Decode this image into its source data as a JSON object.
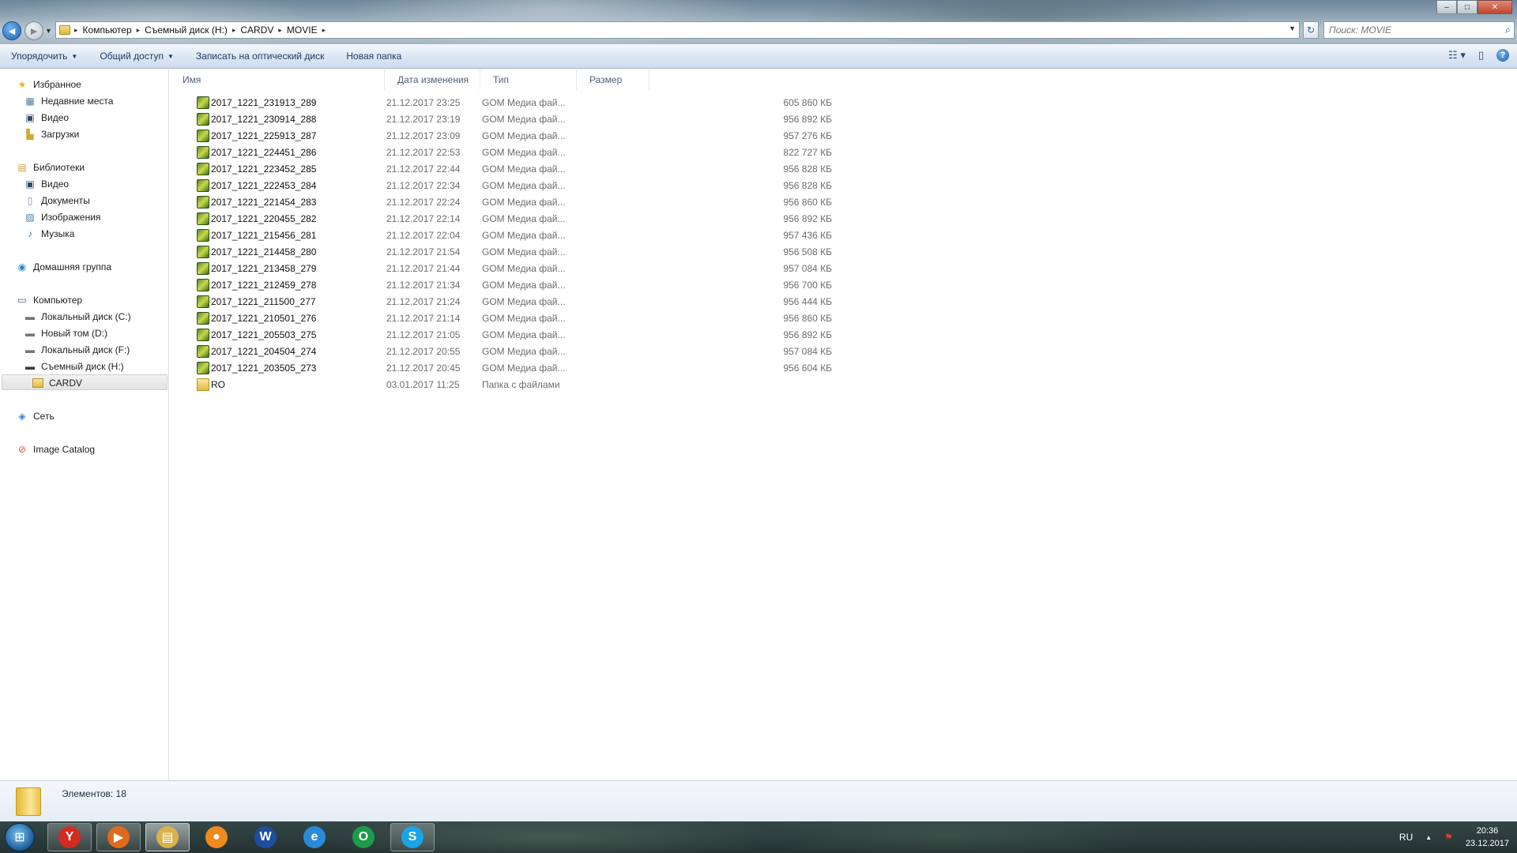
{
  "window": {
    "minimize": "–",
    "maximize": "□",
    "close": "✕"
  },
  "address": {
    "crumbs": [
      "Компьютер",
      "Съемный диск (H:)",
      "CARDV",
      "MOVIE"
    ]
  },
  "search": {
    "placeholder": "Поиск: MOVIE"
  },
  "toolbar": {
    "organize": "Упорядочить",
    "share": "Общий доступ",
    "burn": "Записать на оптический диск",
    "new_folder": "Новая папка"
  },
  "nav": {
    "favorites": "Избранное",
    "recent": "Недавние места",
    "video_fav": "Видео",
    "downloads": "Загрузки",
    "libraries": "Библиотеки",
    "video_lib": "Видео",
    "documents": "Документы",
    "images": "Изображения",
    "music": "Музыка",
    "homegroup": "Домашняя группа",
    "computer": "Компьютер",
    "drive_c": "Локальный диск (C:)",
    "drive_d": "Новый том (D:)",
    "drive_f": "Локальный диск (F:)",
    "drive_h": "Съемный диск (H:)",
    "cardv": "CARDV",
    "network": "Сеть",
    "image_catalog": "Image Catalog"
  },
  "columns": {
    "name": "Имя",
    "date": "Дата изменения",
    "type": "Тип",
    "size": "Размер"
  },
  "files": [
    {
      "name": "2017_1221_231913_289",
      "date": "21.12.2017 23:25",
      "type": "GOM Медиа фай...",
      "size": "605 860 КБ",
      "kind": "video"
    },
    {
      "name": "2017_1221_230914_288",
      "date": "21.12.2017 23:19",
      "type": "GOM Медиа фай...",
      "size": "956 892 КБ",
      "kind": "video"
    },
    {
      "name": "2017_1221_225913_287",
      "date": "21.12.2017 23:09",
      "type": "GOM Медиа фай...",
      "size": "957 276 КБ",
      "kind": "video"
    },
    {
      "name": "2017_1221_224451_286",
      "date": "21.12.2017 22:53",
      "type": "GOM Медиа фай...",
      "size": "822 727 КБ",
      "kind": "video"
    },
    {
      "name": "2017_1221_223452_285",
      "date": "21.12.2017 22:44",
      "type": "GOM Медиа фай...",
      "size": "956 828 КБ",
      "kind": "video"
    },
    {
      "name": "2017_1221_222453_284",
      "date": "21.12.2017 22:34",
      "type": "GOM Медиа фай...",
      "size": "956 828 КБ",
      "kind": "video"
    },
    {
      "name": "2017_1221_221454_283",
      "date": "21.12.2017 22:24",
      "type": "GOM Медиа фай...",
      "size": "956 860 КБ",
      "kind": "video"
    },
    {
      "name": "2017_1221_220455_282",
      "date": "21.12.2017 22:14",
      "type": "GOM Медиа фай...",
      "size": "956 892 КБ",
      "kind": "video"
    },
    {
      "name": "2017_1221_215456_281",
      "date": "21.12.2017 22:04",
      "type": "GOM Медиа фай...",
      "size": "957 436 КБ",
      "kind": "video"
    },
    {
      "name": "2017_1221_214458_280",
      "date": "21.12.2017 21:54",
      "type": "GOM Медиа фай...",
      "size": "956 508 КБ",
      "kind": "video"
    },
    {
      "name": "2017_1221_213458_279",
      "date": "21.12.2017 21:44",
      "type": "GOM Медиа фай...",
      "size": "957 084 КБ",
      "kind": "video"
    },
    {
      "name": "2017_1221_212459_278",
      "date": "21.12.2017 21:34",
      "type": "GOM Медиа фай...",
      "size": "956 700 КБ",
      "kind": "video"
    },
    {
      "name": "2017_1221_211500_277",
      "date": "21.12.2017 21:24",
      "type": "GOM Медиа фай...",
      "size": "956 444 КБ",
      "kind": "video"
    },
    {
      "name": "2017_1221_210501_276",
      "date": "21.12.2017 21:14",
      "type": "GOM Медиа фай...",
      "size": "956 860 КБ",
      "kind": "video"
    },
    {
      "name": "2017_1221_205503_275",
      "date": "21.12.2017 21:05",
      "type": "GOM Медиа фай...",
      "size": "956 892 КБ",
      "kind": "video"
    },
    {
      "name": "2017_1221_204504_274",
      "date": "21.12.2017 20:55",
      "type": "GOM Медиа фай...",
      "size": "957 084 КБ",
      "kind": "video"
    },
    {
      "name": "2017_1221_203505_273",
      "date": "21.12.2017 20:45",
      "type": "GOM Медиа фай...",
      "size": "956 604 КБ",
      "kind": "video"
    },
    {
      "name": "RO",
      "date": "03.01.2017 11:25",
      "type": "Папка с файлами",
      "size": "",
      "kind": "folder"
    }
  ],
  "status": {
    "count": "Элементов: 18"
  },
  "taskbar": {
    "apps": [
      {
        "name": "yandex-browser",
        "glyph": "Y",
        "color": "#d22b1f",
        "state": "running"
      },
      {
        "name": "media-player",
        "glyph": "▶",
        "color": "#e06a1c",
        "state": "running"
      },
      {
        "name": "explorer",
        "glyph": "▤",
        "color": "#d9b24a",
        "state": "active"
      },
      {
        "name": "browser-orange",
        "glyph": "●",
        "color": "#f08a1d",
        "state": "pinned"
      },
      {
        "name": "word",
        "glyph": "W",
        "color": "#1d4f9e",
        "state": "pinned"
      },
      {
        "name": "internet-explorer",
        "glyph": "e",
        "color": "#2a8ad8",
        "state": "pinned"
      },
      {
        "name": "opera",
        "glyph": "O",
        "color": "#1b9c4a",
        "state": "pinned"
      },
      {
        "name": "skype",
        "glyph": "S",
        "color": "#1ba5e6",
        "state": "running"
      }
    ],
    "lang": "RU",
    "tray_arrow": "▲",
    "time": "20:36",
    "date": "23.12.2017"
  }
}
